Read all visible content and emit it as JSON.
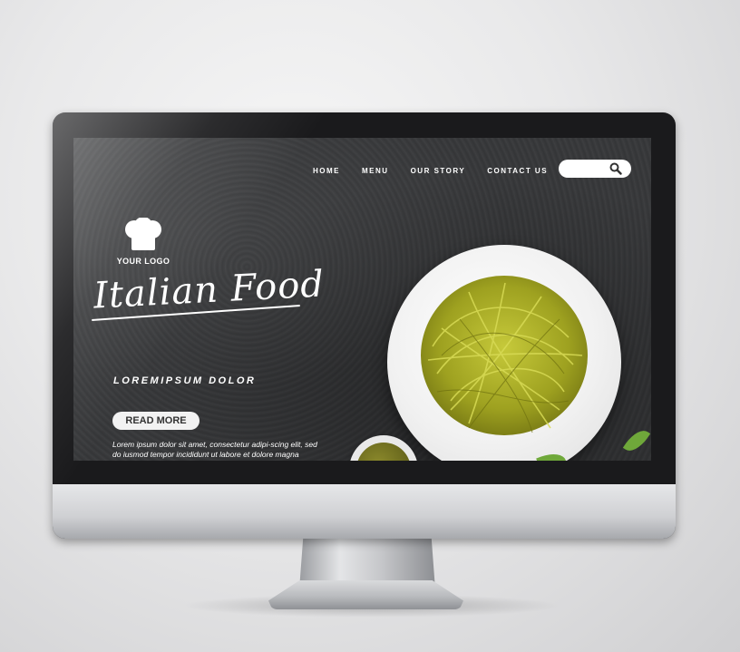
{
  "nav": {
    "items": [
      "HOME",
      "MENU",
      "OUR STORY",
      "CONTACT US"
    ]
  },
  "search": {
    "placeholder": "",
    "icon": "search-icon"
  },
  "logo": {
    "icon": "chef-hat-icon",
    "text": "YOUR LOGO"
  },
  "hero": {
    "title": "Italian Food",
    "subtitle": "LOREMIPSUM DOLOR",
    "button_label": "READ MORE",
    "body": "Lorem ipsum dolor sit amet, consectetur adipi-scing elit, sed do iusmod tempor incididunt ut labore et dolore magna"
  },
  "colors": {
    "background": "#38393b",
    "text": "#ffffff",
    "pasta": "#b3b72a"
  }
}
